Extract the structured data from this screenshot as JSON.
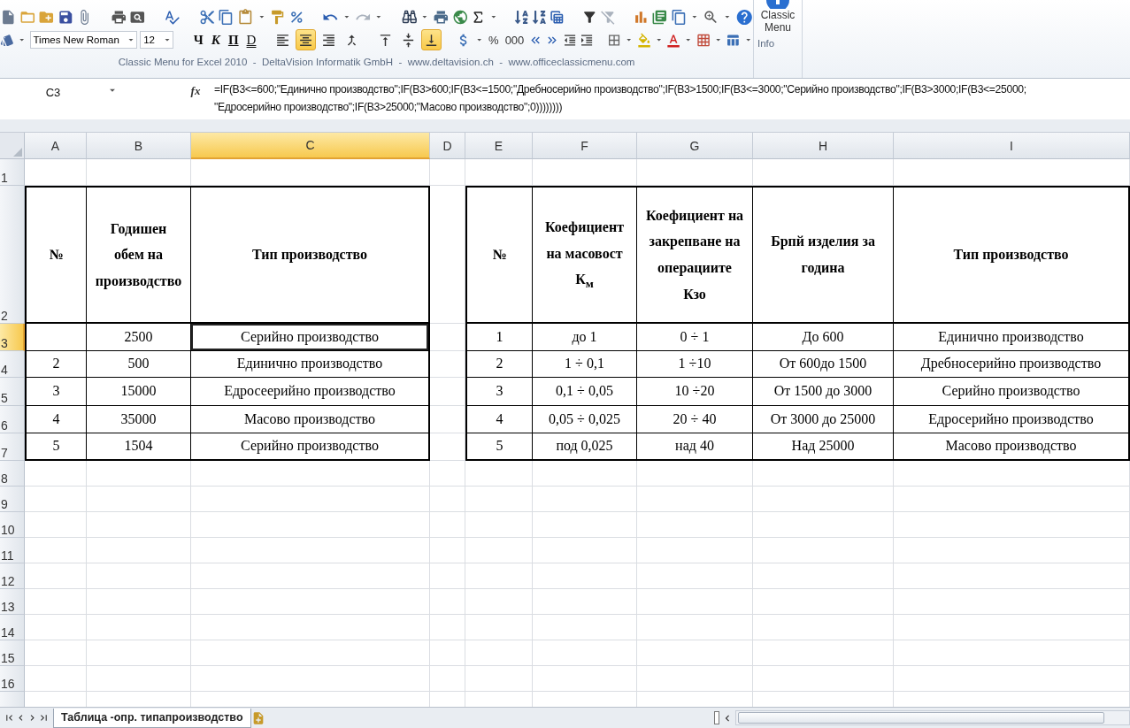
{
  "toolbar": {
    "font": {
      "value": "Times New Roman"
    },
    "size": {
      "value": "12"
    },
    "format_buttons": [
      {
        "kind": "bold",
        "label": "Ч"
      },
      {
        "kind": "italic",
        "label": "К"
      },
      {
        "kind": "underline",
        "label": "П"
      },
      {
        "kind": "double",
        "label": "D"
      }
    ],
    "align_buttons": [
      {
        "kind": "left",
        "selected": false
      },
      {
        "kind": "center",
        "selected": true
      },
      {
        "kind": "right",
        "selected": false
      },
      {
        "kind": "merge",
        "selected": false
      },
      {
        "kind": "top",
        "selected": false
      },
      {
        "kind": "middle",
        "selected": false
      },
      {
        "kind": "bottom",
        "selected": true
      }
    ],
    "number_buttons": [
      "%",
      "000"
    ],
    "credits": "Classic Menu for Excel 2010  -  DeltaVision Informatik GmbH  -  www.deltavision.ch  -  www.officeclassicmenu.com",
    "classic_menu": "Classic\nMenu",
    "group_label": "Info"
  },
  "formula_bar": {
    "name_box": "C3",
    "function_label": "fx",
    "formula": "=IF(B3<=600;\"Единично производство\";IF(B3>600;IF(B3<=1500;\"Дребносерийно производство\";IF(B3>1500;IF(B3<=3000;\"Серийно производство\";IF(B3>3000;IF(B3<=25000;\n\"Едросерийно производство\";IF(B3>25000;\"Масово производство\";0))))))))"
  },
  "sheet": {
    "columns": [
      {
        "label": "A",
        "selected": false
      },
      {
        "label": "B",
        "selected": false
      },
      {
        "label": "C",
        "selected": true
      },
      {
        "label": "D",
        "selected": false
      },
      {
        "label": "E",
        "selected": false
      },
      {
        "label": "F",
        "selected": false
      },
      {
        "label": "G",
        "selected": false
      },
      {
        "label": "H",
        "selected": false
      },
      {
        "label": "I",
        "selected": false
      }
    ],
    "rows": [
      {
        "label": "1",
        "selected": false
      },
      {
        "label": "2",
        "selected": false
      },
      {
        "label": "3",
        "selected": true
      },
      {
        "label": "4",
        "selected": false
      },
      {
        "label": "5",
        "selected": false
      },
      {
        "label": "6",
        "selected": false
      },
      {
        "label": "7",
        "selected": false
      },
      {
        "label": "8",
        "selected": false
      },
      {
        "label": "9",
        "selected": false
      },
      {
        "label": "10",
        "selected": false
      },
      {
        "label": "11",
        "selected": false
      },
      {
        "label": "12",
        "selected": false
      },
      {
        "label": "13",
        "selected": false
      },
      {
        "label": "14",
        "selected": false
      },
      {
        "label": "15",
        "selected": false
      },
      {
        "label": "16",
        "selected": false
      }
    ]
  },
  "table1": {
    "headers": [
      "№",
      "Годишен\nобем на\nпроизводство",
      "Тип производство"
    ],
    "rows": [
      {
        "cells": [
          {
            "selected": false
          },
          {
            "text": "2500",
            "selected": false
          },
          {
            "text": "Серийно производство",
            "selected": true
          }
        ]
      },
      {
        "cells": [
          {
            "text": "2",
            "selected": false
          },
          {
            "text": "500",
            "selected": false
          },
          {
            "text": "Единично производство",
            "selected": false
          }
        ]
      },
      {
        "cells": [
          {
            "text": "3",
            "selected": false
          },
          {
            "text": "15000",
            "selected": false
          },
          {
            "text": "Едросеерийно производство",
            "selected": false
          }
        ]
      },
      {
        "cells": [
          {
            "text": "4",
            "selected": false
          },
          {
            "text": "35000",
            "selected": false
          },
          {
            "text": "Масово производство",
            "selected": false
          }
        ]
      },
      {
        "cells": [
          {
            "text": "5",
            "selected": false
          },
          {
            "text": "1504",
            "selected": false
          },
          {
            "text": "Серийно производство",
            "selected": false
          }
        ]
      }
    ]
  },
  "table2": {
    "headers": [
      "№",
      "Коефициент\nна масовост\nК$_{м}$",
      "Коефициент на\nзакрепване на\nоперациите\nКзо",
      "Брпй изделия за\nгодина",
      "Тип производство"
    ],
    "rows": [
      [
        "1",
        "до 1",
        "0 ÷ 1",
        "До 600",
        "Единично производство"
      ],
      [
        "2",
        "1 ÷ 0,1",
        "1 ÷10",
        "От 600до 1500",
        "Дребносерийно производство"
      ],
      [
        "3",
        "0,1 ÷ 0,05",
        "10 ÷20",
        "От 1500 до 3000",
        "Серийно производство"
      ],
      [
        "4",
        "0,05 ÷ 0,025",
        "20 ÷ 40",
        "От 3000 до 25000",
        "Едросерийно производство"
      ],
      [
        "5",
        "под 0,025",
        "над 40",
        "Над 25000",
        "Масово производство"
      ]
    ]
  },
  "sheet_tabs": [
    {
      "label": "Таблица -опр. типапроизводство",
      "selected": true
    }
  ]
}
